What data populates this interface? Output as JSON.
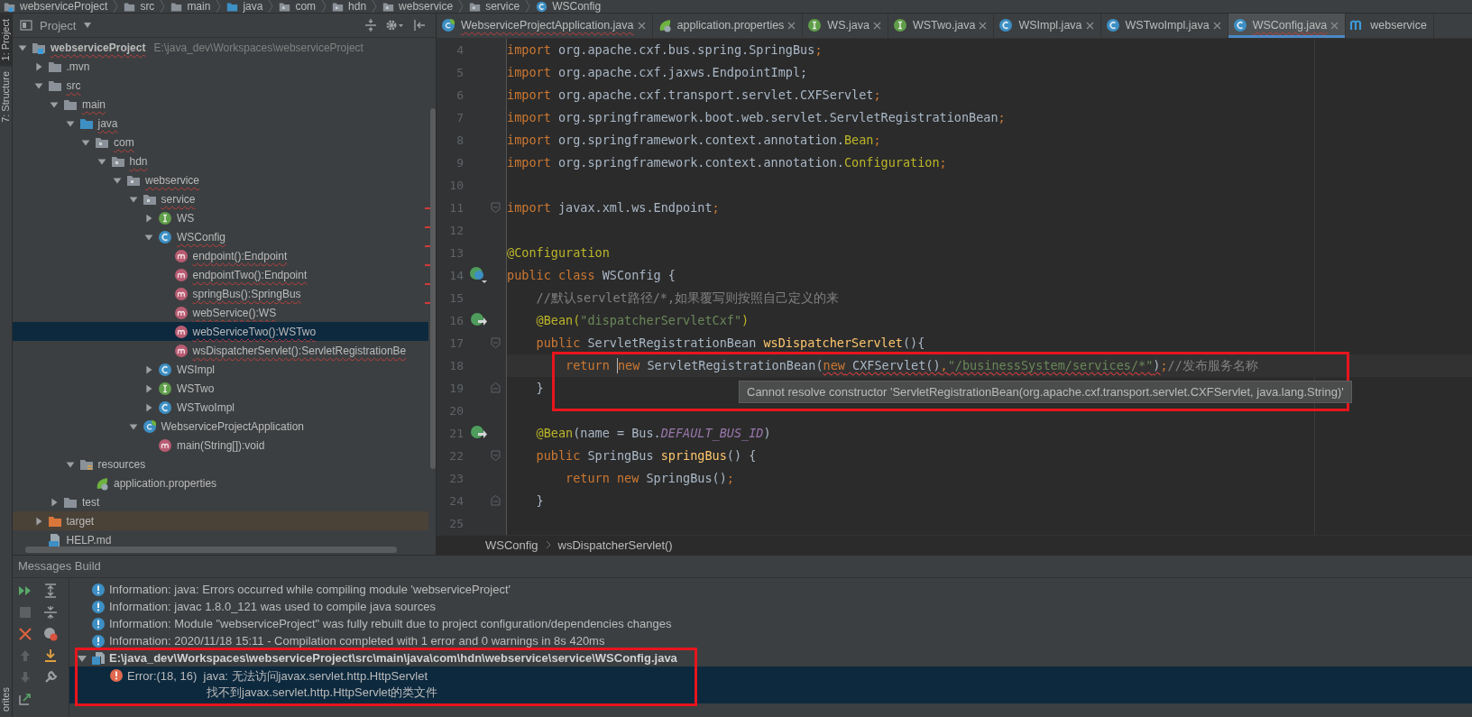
{
  "nav_bar": {
    "items": [
      {
        "label": "webserviceProject",
        "kind": "module"
      },
      {
        "label": "src",
        "kind": "folder"
      },
      {
        "label": "main",
        "kind": "folder"
      },
      {
        "label": "java",
        "kind": "source-folder"
      },
      {
        "label": "com",
        "kind": "package"
      },
      {
        "label": "hdn",
        "kind": "package"
      },
      {
        "label": "webservice",
        "kind": "package"
      },
      {
        "label": "service",
        "kind": "package"
      },
      {
        "label": "WSConfig",
        "kind": "class"
      }
    ]
  },
  "tool_strip": {
    "top": [
      {
        "label": "1: Project",
        "selected": true
      },
      {
        "label": "7: Structure",
        "selected": false
      }
    ],
    "bottom": [
      {
        "label": "orites",
        "selected": false
      }
    ]
  },
  "project": {
    "title": "Project",
    "tree": [
      {
        "label": "webserviceProject",
        "note": "E:\\java_dev\\Workspaces\\webserviceProject",
        "kind": "module",
        "bold": true,
        "error": true,
        "expanded": true,
        "selected": false,
        "children": [
          {
            "label": ".mvn",
            "kind": "folder",
            "expanded": false,
            "selected": false
          },
          {
            "label": "src",
            "kind": "folder",
            "error": true,
            "expanded": true,
            "selected": false,
            "children": [
              {
                "label": "main",
                "kind": "folder",
                "error": true,
                "expanded": true,
                "selected": false,
                "children": [
                  {
                    "label": "java",
                    "kind": "source-folder",
                    "error": true,
                    "expanded": true,
                    "selected": false,
                    "children": [
                      {
                        "label": "com",
                        "kind": "package",
                        "error": true,
                        "expanded": true,
                        "selected": false,
                        "children": [
                          {
                            "label": "hdn",
                            "kind": "package",
                            "error": true,
                            "expanded": true,
                            "selected": false,
                            "children": [
                              {
                                "label": "webservice",
                                "kind": "package",
                                "error": true,
                                "expanded": true,
                                "selected": false,
                                "children": [
                                  {
                                    "label": "service",
                                    "kind": "package",
                                    "error": true,
                                    "expanded": true,
                                    "selected": false,
                                    "children": [
                                      {
                                        "label": "WS",
                                        "kind": "interface",
                                        "expanded": false,
                                        "selected": false,
                                        "error_mark": true
                                      },
                                      {
                                        "label": "WSConfig",
                                        "kind": "class",
                                        "error": true,
                                        "expanded": true,
                                        "selected": false,
                                        "error_mark": true,
                                        "children": [
                                          {
                                            "label": "endpoint():Endpoint",
                                            "kind": "method",
                                            "error": true,
                                            "selected": false,
                                            "error_mark": true
                                          },
                                          {
                                            "label": "endpointTwo():Endpoint",
                                            "kind": "method",
                                            "error": true,
                                            "selected": false,
                                            "error_mark": true
                                          },
                                          {
                                            "label": "springBus():SpringBus",
                                            "kind": "method",
                                            "error": true,
                                            "selected": false,
                                            "error_mark": true
                                          },
                                          {
                                            "label": "webService():WS",
                                            "kind": "method",
                                            "error": true,
                                            "selected": false,
                                            "error_mark": true
                                          },
                                          {
                                            "label": "webServiceTwo():WSTwo",
                                            "kind": "method",
                                            "error": true,
                                            "selected": true
                                          },
                                          {
                                            "label": "wsDispatcherServlet():ServletRegistrationBe",
                                            "kind": "method",
                                            "error": true,
                                            "selected": false
                                          }
                                        ]
                                      },
                                      {
                                        "label": "WSImpl",
                                        "kind": "class",
                                        "expanded": false,
                                        "selected": false
                                      },
                                      {
                                        "label": "WSTwo",
                                        "kind": "interface",
                                        "expanded": false,
                                        "selected": false
                                      },
                                      {
                                        "label": "WSTwoImpl",
                                        "kind": "class",
                                        "expanded": false,
                                        "selected": false
                                      }
                                    ]
                                  },
                                  {
                                    "label": "WebserviceProjectApplication",
                                    "kind": "spring-app",
                                    "expanded": true,
                                    "selected": false,
                                    "children": [
                                      {
                                        "label": "main(String[]):void",
                                        "kind": "method",
                                        "selected": false
                                      }
                                    ]
                                  }
                                ]
                              }
                            ]
                          }
                        ]
                      }
                    ]
                  },
                  {
                    "label": "resources",
                    "kind": "resource-folder",
                    "expanded": true,
                    "selected": false,
                    "children": [
                      {
                        "label": "application.properties",
                        "kind": "properties",
                        "selected": false
                      }
                    ]
                  }
                ]
              },
              {
                "label": "test",
                "kind": "folder",
                "expanded": false,
                "selected": false
              }
            ]
          },
          {
            "label": "target",
            "kind": "excluded-folder",
            "expanded": false,
            "selected": false
          },
          {
            "label": "HELP.md",
            "kind": "markdown",
            "selected": false
          }
        ]
      }
    ]
  },
  "editor": {
    "tabs": [
      {
        "label": "WebserviceProjectApplication.java",
        "kind": "spring-app",
        "error": true,
        "selected": false
      },
      {
        "label": "application.properties",
        "kind": "properties",
        "error": false,
        "selected": false
      },
      {
        "label": "WS.java",
        "kind": "interface",
        "error": false,
        "selected": false
      },
      {
        "label": "WSTwo.java",
        "kind": "interface",
        "error": false,
        "selected": false
      },
      {
        "label": "WSImpl.java",
        "kind": "class",
        "error": false,
        "selected": false
      },
      {
        "label": "WSTwoImpl.java",
        "kind": "class",
        "error": false,
        "selected": false
      },
      {
        "label": "WSConfig.java",
        "kind": "class",
        "error": true,
        "selected": true
      },
      {
        "label": "webservice",
        "kind": "maven",
        "error": false,
        "selected": false
      }
    ],
    "lines": [
      {
        "number": "4",
        "tokens": [
          {
            "kind": "kw",
            "text": "import"
          },
          {
            "kind": "plain",
            "text": " org.apache.cxf.bus.spring.SpringBus"
          },
          {
            "kind": "kw",
            "text": ";"
          }
        ]
      },
      {
        "number": "5",
        "tokens": [
          {
            "kind": "kw",
            "text": "import"
          },
          {
            "kind": "plain",
            "text": " org.apache.cxf.jaxws.EndpointImpl;"
          }
        ]
      },
      {
        "number": "6",
        "tokens": [
          {
            "kind": "kw",
            "text": "import"
          },
          {
            "kind": "plain",
            "text": " org.apache.cxf.transport.servlet.CXFServlet"
          },
          {
            "kind": "kw",
            "text": ";"
          }
        ]
      },
      {
        "number": "7",
        "tokens": [
          {
            "kind": "kw",
            "text": "import"
          },
          {
            "kind": "plain",
            "text": " org.springframework.boot.web.servlet.ServletRegistrationBean"
          },
          {
            "kind": "kw",
            "text": ";"
          }
        ]
      },
      {
        "number": "8",
        "tokens": [
          {
            "kind": "kw",
            "text": "import"
          },
          {
            "kind": "plain",
            "text": " org.springframework.context.annotation."
          },
          {
            "kind": "ann",
            "text": "Bean"
          },
          {
            "kind": "kw",
            "text": ";"
          }
        ]
      },
      {
        "number": "9",
        "tokens": [
          {
            "kind": "kw",
            "text": "import"
          },
          {
            "kind": "plain",
            "text": " org.springframework.context.annotation."
          },
          {
            "kind": "ann",
            "text": "Configuration"
          },
          {
            "kind": "kw",
            "text": ";"
          }
        ]
      },
      {
        "number": "10"
      },
      {
        "number": "11",
        "fold_start": true,
        "tokens": [
          {
            "kind": "kw",
            "text": "import"
          },
          {
            "kind": "plain",
            "text": " javax.xml.ws.Endpoint"
          },
          {
            "kind": "kw",
            "text": ";"
          }
        ]
      },
      {
        "number": "12"
      },
      {
        "number": "13",
        "tokens": [
          {
            "kind": "ann",
            "text": "@Configuration"
          }
        ]
      },
      {
        "number": "14",
        "class_bean": true,
        "tokens": [
          {
            "kind": "kw",
            "text": "public class"
          },
          {
            "kind": "plain",
            "text": " WSConfig {"
          }
        ]
      },
      {
        "number": "15",
        "tokens": [
          {
            "kind": "com",
            "text": "    //默认servlet路径/*,如果覆写则按照自己定义的来"
          }
        ]
      },
      {
        "number": "16",
        "bean": true,
        "tokens": [
          {
            "kind": "ann",
            "text": "    @Bean("
          },
          {
            "kind": "str",
            "text": "\"dispatcherServletCxf\""
          },
          {
            "kind": "ann",
            "text": ")"
          }
        ]
      },
      {
        "number": "17",
        "fold_start": true,
        "tokens": [
          {
            "kind": "kw",
            "text": "    public"
          },
          {
            "kind": "plain",
            "text": " ServletRegistrationBean "
          },
          {
            "kind": "method",
            "text": "wsDispatcherServlet"
          },
          {
            "kind": "plain",
            "text": "(){"
          }
        ]
      },
      {
        "number": "18",
        "current": true,
        "tokens": [
          {
            "kind": "kw",
            "text": "        return "
          },
          {
            "kind": "kw",
            "text": "new",
            "caret": true
          },
          {
            "kind": "plain",
            "text": " ServletRegistrationBean("
          },
          {
            "kind": "group",
            "error": true,
            "tokens": [
              {
                "kind": "kw",
                "text": "new"
              },
              {
                "kind": "plain",
                "text": " CXFServlet()"
              },
              {
                "kind": "kw",
                "text": ","
              },
              {
                "kind": "str",
                "text": "\"/businessSystem/services/*\""
              },
              {
                "kind": "plain",
                "text": ")"
              }
            ]
          },
          {
            "kind": "kw",
            "text": ";"
          },
          {
            "kind": "com",
            "text": "//发布服务名称"
          }
        ]
      },
      {
        "number": "19",
        "fold_end": true,
        "tokens": [
          {
            "kind": "plain",
            "text": "    }"
          }
        ]
      },
      {
        "number": "20"
      },
      {
        "number": "21",
        "bean": true,
        "tokens": [
          {
            "kind": "ann",
            "text": "    @Bean"
          },
          {
            "kind": "plain",
            "text": "(name = Bus."
          },
          {
            "kind": "const",
            "text": "DEFAULT_BUS_ID"
          },
          {
            "kind": "plain",
            "text": ")"
          }
        ]
      },
      {
        "number": "22",
        "fold_start": true,
        "tokens": [
          {
            "kind": "kw",
            "text": "    public"
          },
          {
            "kind": "plain",
            "text": " SpringBus "
          },
          {
            "kind": "method",
            "text": "springBus"
          },
          {
            "kind": "plain",
            "text": "() {"
          }
        ]
      },
      {
        "number": "23",
        "tokens": [
          {
            "kind": "kw",
            "text": "        return new"
          },
          {
            "kind": "plain",
            "text": " SpringBus()"
          },
          {
            "kind": "kw",
            "text": ";"
          }
        ]
      },
      {
        "number": "24",
        "fold_end": true,
        "tokens": [
          {
            "kind": "plain",
            "text": "    }"
          }
        ]
      },
      {
        "number": "25"
      }
    ],
    "highlight_frame": true,
    "tooltip": "Cannot resolve constructor 'ServletRegistrationBean(org.apache.cxf.transport.servlet.CXFServlet, java.lang.String)'",
    "breadcrumbs": [
      "WSConfig",
      "wsDispatcherServlet()"
    ]
  },
  "messages": {
    "title": "Messages Build",
    "items": [
      {
        "kind": "info",
        "text": "Information: java: Errors occurred while compiling module 'webserviceProject'",
        "selected": false
      },
      {
        "kind": "info",
        "text": "Information: javac 1.8.0_121 was used to compile java sources",
        "selected": false
      },
      {
        "kind": "info",
        "text": "Information: Module \"webserviceProject\" was fully rebuilt due to project configuration/dependencies changes",
        "selected": false
      },
      {
        "kind": "info",
        "text": "Information: 2020/11/18 15:11 - Compilation completed with 1 error and 0 warnings in 8s 420ms",
        "selected": false
      },
      {
        "kind": "file",
        "text": "E:\\java_dev\\Workspaces\\webserviceProject\\src\\main\\java\\com\\hdn\\webservice\\service\\WSConfig.java",
        "selected": false,
        "expanded": true,
        "framed": true,
        "children": [
          {
            "kind": "error",
            "lines": [
              "Error:(18, 16)  java: 无法访问javax.servlet.http.HttpServlet",
              "找不到javax.servlet.http.HttpServlet的类文件"
            ],
            "selected": true
          }
        ]
      }
    ]
  }
}
